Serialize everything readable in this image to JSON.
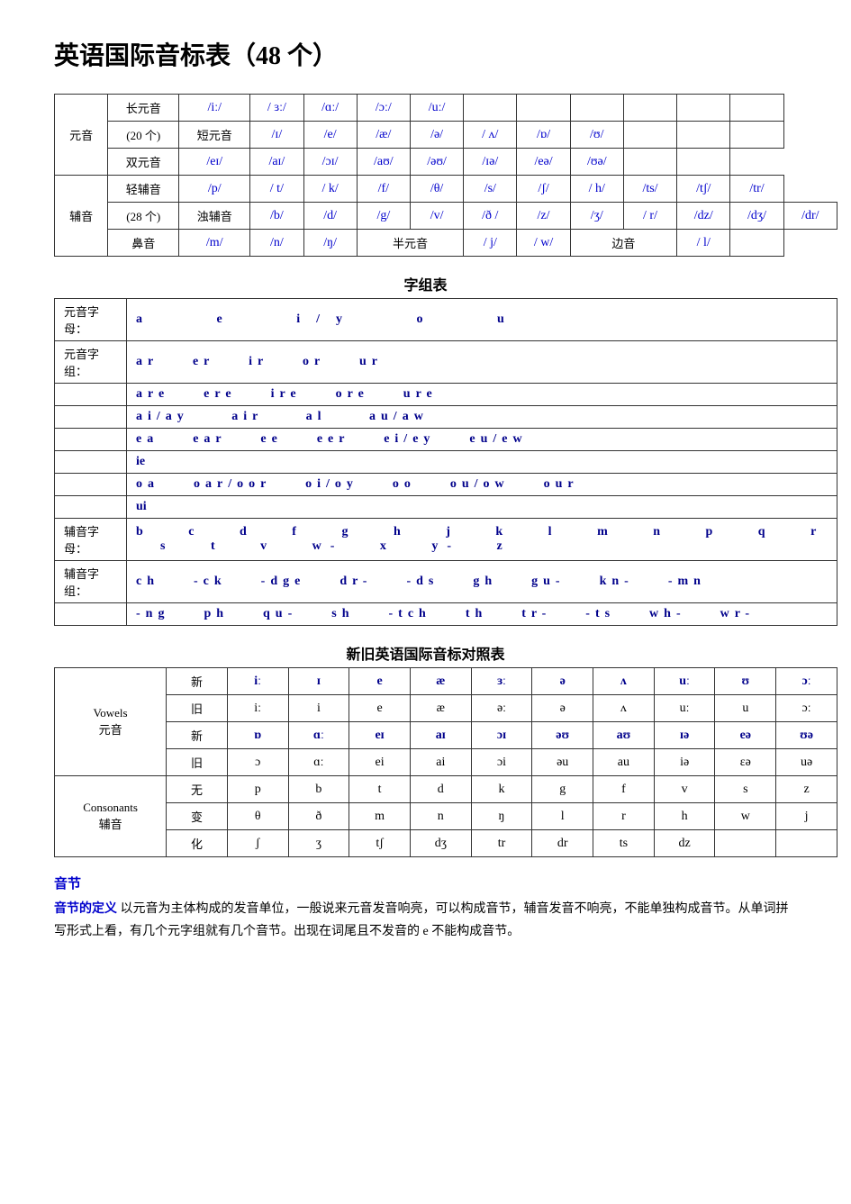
{
  "title": "英语国际音标表（48 个）",
  "phonetic_table": {
    "rows": [
      {
        "category": "元音",
        "subcategory": "长元音",
        "symbols": [
          "/iː/",
          "/ ɜː/",
          "/ɑː/",
          "/ɔː/",
          "/uː/",
          "",
          "",
          "",
          "",
          "",
          ""
        ]
      },
      {
        "category": "(20 个)",
        "subcategory": "短元音",
        "symbols": [
          "/ɪ/",
          "/e/",
          "/æ/",
          "/ə/",
          "/ ʌ/",
          "/ɒ/",
          "/ʊ/",
          "",
          "",
          "",
          ""
        ]
      },
      {
        "category": "",
        "subcategory": "双元音",
        "symbols": [
          "/eɪ/",
          "/aɪ/",
          "/ɔɪ/",
          "/aʊ/",
          "/əʊ/",
          "/ɪə/",
          "/eə/",
          "/ʊə/",
          "",
          "",
          ""
        ]
      },
      {
        "category": "辅音",
        "subcategory": "清辅音",
        "symbols": [
          "/p/",
          "/ t/",
          "/ k/",
          "/f/",
          "/θ/",
          "/s/",
          "/ʃ/",
          "/ h/",
          "/ts/",
          "/tʃ/",
          "/tr/"
        ]
      },
      {
        "category": "(28 个)",
        "subcategory": "浊辅音",
        "symbols": [
          "/b/",
          "/d/",
          "/g/",
          "/v/",
          "/ð /",
          "/z/",
          "/ʒ/",
          "/ r/",
          "/dz/",
          "/dʒ/",
          "/dr/"
        ]
      },
      {
        "category": "",
        "subcategory": "鼻音",
        "symbols": [
          "/m/",
          "/n/",
          "/ŋ/",
          "半元音",
          "/ j/",
          "/ w/",
          "边音",
          "/ l/",
          "",
          "",
          ""
        ]
      }
    ]
  },
  "zizu_title": "字组表",
  "zizu_rows": [
    {
      "label": "元音字母：",
      "content": "a    e    i/y    o    u"
    },
    {
      "label": "元音字组：",
      "content": "ar    er    ir    or    ur"
    },
    {
      "label": "",
      "content": "are    ere    ire    ore    ure"
    },
    {
      "label": "",
      "content": "ai/ay    air    al    au/aw"
    },
    {
      "label": "",
      "content": "ea    ear    ee    eer    ei/ey    eu/ew"
    },
    {
      "label": "",
      "content": "ie"
    },
    {
      "label": "",
      "content": "oa    oar/oor    oi/oy    oo    ou/ow    our"
    },
    {
      "label": "",
      "content": "ui"
    },
    {
      "label": "辅音字母：",
      "content": "b    c    d    f    g    h    j    k    l    m    n    p    q    r    s    t    v    w-    x    y-    z"
    },
    {
      "label": "辅音字组：",
      "content": "ch    -ck    -dge    dr-    -ds    gh    gu-    kn-    -mn"
    },
    {
      "label": "",
      "content": "-ng    ph    qu-    sh    -tch    th    tr-    -ts    wh-    wr-"
    }
  ],
  "contrast_title": "新旧英语国际音标对照表",
  "contrast_groups": [
    {
      "group": "Vowels",
      "subgroup": "元音",
      "rows": [
        {
          "type": "新",
          "symbols": [
            "iː",
            "ɪ",
            "e",
            "æ",
            "ɜː",
            "ə",
            "ʌ",
            "uː",
            "ʊ",
            "ɔː"
          ]
        },
        {
          "type": "旧",
          "symbols": [
            "iː",
            "i",
            "e",
            "æ",
            "əː",
            "ə",
            "ʌ",
            "uː",
            "u",
            "ɔː"
          ]
        },
        {
          "type": "新",
          "symbols": [
            "ɒ",
            "ɑː",
            "eɪ",
            "aɪ",
            "ɔɪ",
            "əʊ",
            "aʊ",
            "ɪə",
            "eə",
            "ʊə"
          ]
        },
        {
          "type": "旧",
          "symbols": [
            "ɔ",
            "ɑː",
            "ei",
            "ai",
            "ɔi",
            "əu",
            "au",
            "iə",
            "εə",
            "uə"
          ]
        }
      ]
    },
    {
      "group": "Consonants",
      "subgroup": "辅音",
      "rows": [
        {
          "type": "无",
          "symbols": [
            "p",
            "b",
            "t",
            "d",
            "k",
            "g",
            "f",
            "v",
            "s",
            "z"
          ]
        },
        {
          "type": "变",
          "symbols": [
            "θ",
            "ð",
            "m",
            "n",
            "ŋ",
            "l",
            "r",
            "h",
            "w",
            "j"
          ]
        },
        {
          "type": "化",
          "symbols": [
            "ʃ",
            "ʒ",
            "tʃ",
            "dʒ",
            "tr",
            "dr",
            "ts",
            "dz",
            "",
            ""
          ]
        }
      ]
    }
  ],
  "section_heading": "音节",
  "definition_label": "音节的定义",
  "definition_text": "  以元音为主体构成的发音单位，一般说来元音发音响亮，可以构成音节，辅音发音不响亮，不能单独构成音节。从单词拼写形式上看，有几个元字组就有几个音节。出现在词尾且不发音的 e 不能构成音节。"
}
